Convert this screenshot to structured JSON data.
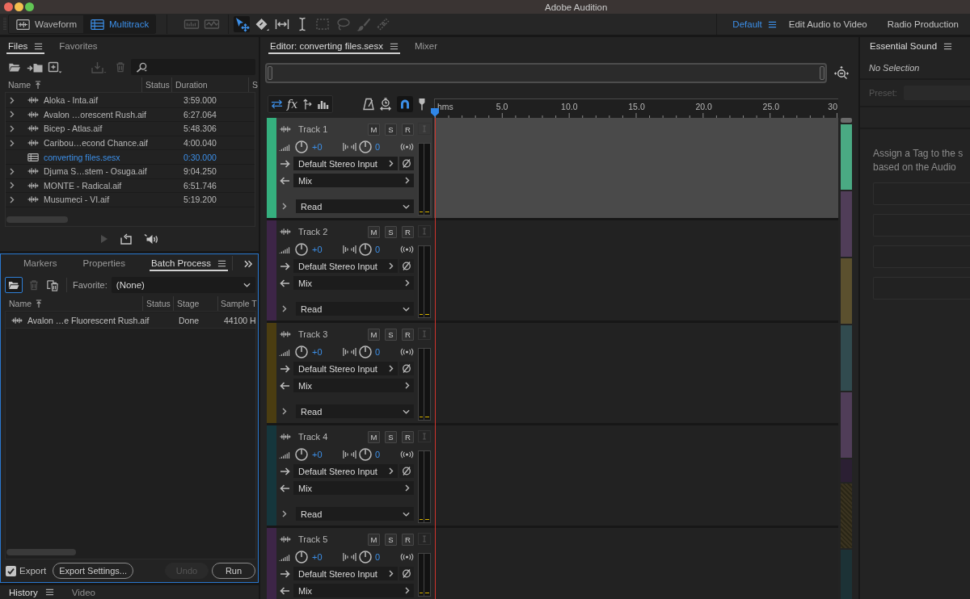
{
  "window": {
    "title": "Adobe Audition"
  },
  "modes": [
    {
      "label": "Waveform",
      "selected": false
    },
    {
      "label": "Multitrack",
      "selected": true
    }
  ],
  "tools": [
    {
      "selected": false,
      "disabled": true
    },
    {
      "selected": false,
      "disabled": true
    },
    {
      "selected": true,
      "disabled": false
    },
    {
      "selected": false,
      "disabled": false
    },
    {
      "selected": false,
      "disabled": false
    },
    {
      "selected": false,
      "disabled": false
    },
    {
      "selected": false,
      "disabled": true
    },
    {
      "selected": false,
      "disabled": true
    },
    {
      "selected": false,
      "disabled": true
    },
    {
      "selected": false,
      "disabled": true
    }
  ],
  "workspaces": [
    {
      "label": "Default",
      "selected": true
    },
    {
      "label": "Edit Audio to Video",
      "selected": false
    },
    {
      "label": "Radio Production",
      "selected": false
    }
  ],
  "files_panel": {
    "tabs": [
      {
        "label": "Files",
        "selected": true
      },
      {
        "label": "Favorites",
        "selected": false
      }
    ],
    "tools": [
      {
        "disabled": false
      },
      {
        "disabled": false
      },
      {
        "disabled": false
      },
      {
        "disabled": true
      },
      {
        "disabled": true
      }
    ],
    "columns": [
      "Name",
      "Status",
      "Duration",
      "S"
    ],
    "files": [
      {
        "kind": "audio",
        "name": "Aloka - Inta.aif",
        "duration": "3:59.000",
        "active": false
      },
      {
        "kind": "audio",
        "name": "Avalon …orescent Rush.aif",
        "duration": "6:27.064",
        "active": false
      },
      {
        "kind": "audio",
        "name": "Bicep - Atlas.aif",
        "duration": "5:48.306",
        "active": false
      },
      {
        "kind": "audio",
        "name": "Caribou…econd Chance.aif",
        "duration": "4:00.040",
        "active": false
      },
      {
        "kind": "session",
        "name": "converting files.sesx",
        "duration": "0:30.000",
        "active": true
      },
      {
        "kind": "audio",
        "name": "Djuma S…stem - Osuga.aif",
        "duration": "9:04.250",
        "active": false
      },
      {
        "kind": "audio",
        "name": "MONTE - Radical.aif",
        "duration": "6:51.746",
        "active": false
      },
      {
        "kind": "audio",
        "name": "Musumeci - VI.aif",
        "duration": "5:19.200",
        "active": false
      }
    ],
    "transport": [
      {
        "disabled": true
      },
      {
        "disabled": false
      },
      {
        "disabled": false
      }
    ]
  },
  "batch_panel": {
    "focused": true,
    "tabs": [
      {
        "label": "Markers",
        "selected": false
      },
      {
        "label": "Properties",
        "selected": false
      },
      {
        "label": "Batch Process",
        "selected": true
      }
    ],
    "tools": [
      {
        "selected": true,
        "disabled": false
      },
      {
        "selected": false,
        "disabled": true
      },
      {
        "selected": false,
        "disabled": false
      }
    ],
    "favorite": {
      "label": "Favorite:",
      "value": "(None)"
    },
    "columns": [
      "Name",
      "Status",
      "Stage",
      "Sample T"
    ],
    "rows": [
      {
        "name": "Avalon …e Fluorescent Rush.aif",
        "stage": "Done",
        "column_4": "44100 H"
      }
    ],
    "export": {
      "label": "Export",
      "checked": true
    },
    "buttons": [
      {
        "label": "Export Settings...",
        "disabled": false
      },
      {
        "label": "Undo",
        "disabled": true
      },
      {
        "label": "Run",
        "disabled": false
      }
    ]
  },
  "history_panel": {
    "tabs": [
      {
        "label": "History",
        "selected": true
      },
      {
        "label": "Video",
        "selected": false
      }
    ]
  },
  "editor": {
    "tabs": [
      {
        "label": "Editor: converting files.sesx",
        "selected": true
      },
      {
        "label": "Mixer",
        "selected": false
      }
    ],
    "left_tools": [
      {
        "selected": true
      },
      {
        "label": "fx",
        "selected": false
      },
      {
        "selected": false
      },
      {
        "selected": false
      }
    ],
    "right_tools": [
      {
        "selected": false
      },
      {
        "selected": false
      },
      {
        "selected": true
      },
      {
        "selected": false
      }
    ],
    "ruler": {
      "unit": "hms",
      "ticks": [
        "5.0",
        "10.0",
        "15.0",
        "20.0",
        "25.0",
        "30"
      ]
    },
    "tracks": [
      {
        "name": "Track 1",
        "color": "#35b07e",
        "selected": true,
        "buttons": [
          "M",
          "S",
          "R"
        ],
        "volume": "+0",
        "pan": "0",
        "input": "Default Stereo Input",
        "output": "Mix",
        "automation": "Read"
      },
      {
        "name": "Track 2",
        "color": "#3d2547",
        "selected": false,
        "buttons": [
          "M",
          "S",
          "R"
        ],
        "volume": "+0",
        "pan": "0",
        "input": "Default Stereo Input",
        "output": "Mix",
        "automation": "Read"
      },
      {
        "name": "Track 3",
        "color": "#4b3d11",
        "selected": false,
        "buttons": [
          "M",
          "S",
          "R"
        ],
        "volume": "+0",
        "pan": "0",
        "input": "Default Stereo Input",
        "output": "Mix",
        "automation": "Read"
      },
      {
        "name": "Track 4",
        "color": "#15363c",
        "selected": false,
        "buttons": [
          "M",
          "S",
          "R"
        ],
        "volume": "+0",
        "pan": "0",
        "input": "Default Stereo Input",
        "output": "Mix",
        "automation": "Read"
      },
      {
        "name": "Track 5",
        "color": "#3d2547",
        "selected": false,
        "buttons": [
          "M",
          "S",
          "R"
        ],
        "volume": "+0",
        "pan": "0",
        "input": "Default Stereo Input",
        "output": "Mix"
      }
    ]
  },
  "essential_sound": {
    "tabs": [
      {
        "label": "Essential Sound",
        "selected": true
      }
    ],
    "selection": "No Selection",
    "preset": {
      "label": "Preset:",
      "disabled": true
    },
    "message": [
      "Assign a Tag to the s",
      "based on the Audio"
    ]
  }
}
